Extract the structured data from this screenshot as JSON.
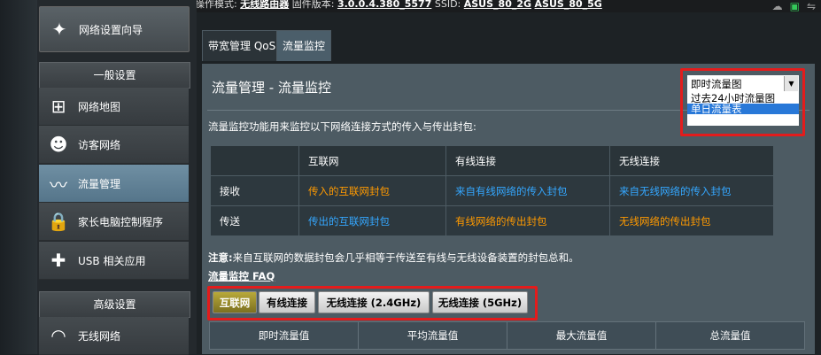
{
  "topbar": {
    "mode_label": "操作模式:",
    "mode_value": "无线路由器",
    "firmware_label": "固件版本:",
    "firmware_value": "3.0.0.4.380_5577",
    "ssid_label": "SSID:",
    "ssid_2g": "ASUS_80_2G",
    "ssid_5g": "ASUS_80_5G"
  },
  "sidebar": {
    "wizard": "网络设置向导",
    "section_general": "一般设置",
    "items": [
      {
        "label": "网络地图",
        "icon": "network-map-icon"
      },
      {
        "label": "访客网络",
        "icon": "guest-network-icon"
      },
      {
        "label": "流量管理",
        "icon": "traffic-manager-icon",
        "active": true
      },
      {
        "label": "家长电脑控制程序",
        "icon": "parental-control-icon"
      },
      {
        "label": "USB 相关应用",
        "icon": "usb-app-icon"
      }
    ],
    "section_advanced": "高级设置",
    "advanced_items": [
      {
        "label": "无线网络",
        "icon": "wireless-icon"
      }
    ]
  },
  "tabs": [
    {
      "label": "带宽管理 QoS"
    },
    {
      "label": "流量监控",
      "active": true
    }
  ],
  "main": {
    "title": "流量管理 - 流量监控",
    "description": "流量监控功能用来监控以下网络连接方式的传入与传出封包:",
    "select": {
      "value": "即时流量图",
      "options": [
        "即时流量图",
        "过去24小时流量图",
        "单日流量表"
      ],
      "highlighted": "单日流量表"
    },
    "info_table": {
      "headers": [
        "",
        "互联网",
        "有线连接",
        "无线连接"
      ],
      "rows": [
        {
          "label": "接收",
          "cells": [
            "传入的互联网封包",
            "来自有线网络的传入封包",
            "来自无线网络的传入封包"
          ]
        },
        {
          "label": "传送",
          "cells": [
            "传出的互联网封包",
            "有线网络的传出封包",
            "无线网络的传出封包"
          ]
        }
      ]
    },
    "note_prefix": "注意:",
    "note": "来自互联网的数据封包会几乎相等于传送至有线与无线设备装置的封包总和。",
    "faq": "流量监控 FAQ",
    "buttons": [
      "互联网",
      "有线连接",
      "无线连接 (2.4GHz)",
      "无线连接 (5GHz)"
    ],
    "stats_headers": [
      "即时流量值",
      "平均流量值",
      "最大流量值",
      "总流量值"
    ]
  },
  "colors": {
    "accent_orange": "#ff9a00",
    "link_blue": "#34a7ff",
    "highlight_red": "#e31c1c"
  }
}
